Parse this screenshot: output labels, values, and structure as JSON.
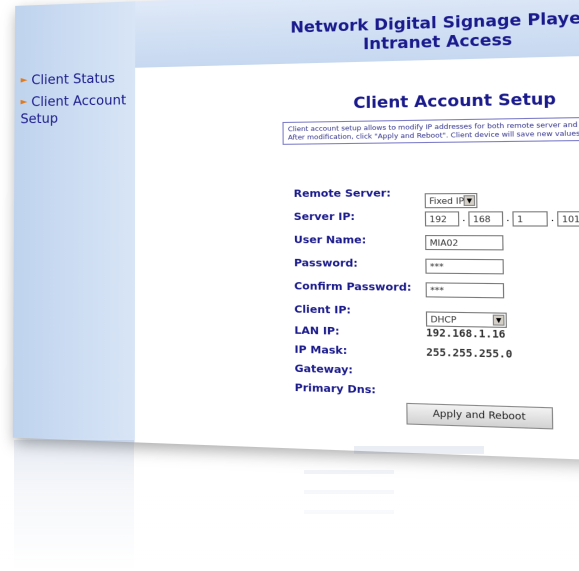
{
  "header": {
    "title_line1": "Network Digital Signage Player",
    "title_line2": "Intranet Access"
  },
  "sidebar": {
    "items": [
      {
        "label": "Client Status"
      },
      {
        "label": "Client Account Setup"
      }
    ]
  },
  "main": {
    "title": "Client Account Setup",
    "description": "Client account setup allows to modify IP addresses for both remote server and client device. After modification, click \"Apply and Reboot\". Client device will save new values and restart.",
    "fields": {
      "remote_server": {
        "label": "Remote Server:",
        "value": "Fixed IP"
      },
      "server_ip": {
        "label": "Server IP:",
        "octets": [
          "192",
          "168",
          "1",
          "101"
        ]
      },
      "user_name": {
        "label": "User Name:",
        "value": "MIA02"
      },
      "password": {
        "label": "Password:",
        "value": "***"
      },
      "confirm_password": {
        "label": "Confirm Password:",
        "value": "***"
      },
      "client_ip": {
        "label": "Client IP:",
        "value": "DHCP"
      },
      "lan_ip": {
        "label": "LAN IP:",
        "value": "192.168.1.16"
      },
      "ip_mask": {
        "label": "IP Mask:",
        "value": "255.255.255.0"
      },
      "gateway": {
        "label": "Gateway:",
        "value": ""
      },
      "primary_dns": {
        "label": "Primary Dns:",
        "value": ""
      }
    },
    "apply_button": "Apply and Reboot"
  },
  "colors": {
    "title": "#1a1a8c",
    "sidebar_bg": "#c6d8f0",
    "bullet": "#e07a1c"
  }
}
